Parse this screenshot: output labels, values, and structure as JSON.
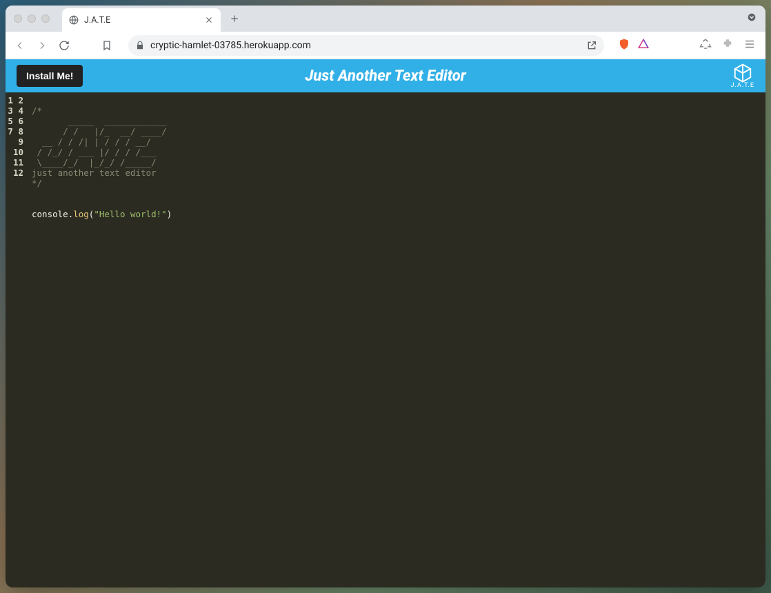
{
  "browser": {
    "tab_title": "J.A.T.E",
    "url": "cryptic-hamlet-03785.herokuapp.com"
  },
  "app": {
    "install_label": "Install Me!",
    "title": "Just Another Text Editor",
    "logo_sub": "J.A.T.E"
  },
  "editor": {
    "line_count": 12,
    "lines": {
      "l1": "",
      "l2": "/*",
      "l3": "       _____  ____________",
      "l4": "      / /   |/_  __/ ____/",
      "l5": "  __ / / /| | / / / __/",
      "l6": " / /_/ / ___ |/ / / /___",
      "l7": " \\____/_/  |_/_/ /_____/",
      "l8": "just another text editor",
      "l9": "*/",
      "l10": "",
      "l11": "",
      "l12_a": "console",
      "l12_b": ".",
      "l12_c": "log",
      "l12_d": "(",
      "l12_e": "\"Hello world!\"",
      "l12_f": ")"
    }
  }
}
